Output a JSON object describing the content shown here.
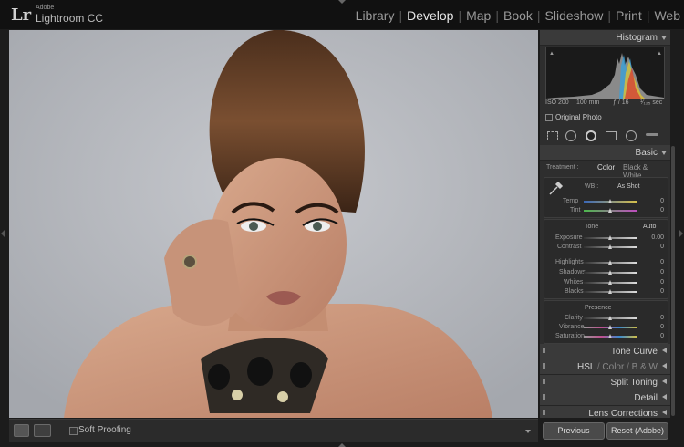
{
  "app": {
    "small": "Adobe",
    "name": "Lightroom CC",
    "logo": "Lr"
  },
  "modules": [
    {
      "label": "Library",
      "active": false
    },
    {
      "label": "Develop",
      "active": true
    },
    {
      "label": "Map",
      "active": false
    },
    {
      "label": "Book",
      "active": false
    },
    {
      "label": "Slideshow",
      "active": false
    },
    {
      "label": "Print",
      "active": false
    },
    {
      "label": "Web",
      "active": false
    }
  ],
  "toolbar": {
    "soft_proofing": "Soft Proofing"
  },
  "histogram": {
    "title": "Histogram",
    "iso": "ISO 200",
    "focal": "100 mm",
    "aperture": "ƒ / 16",
    "shutter": "¹⁄₁₂₅ sec",
    "original_photo": "Original Photo"
  },
  "basic": {
    "title": "Basic",
    "treatment_label": "Treatment :",
    "treatment_color": "Color",
    "treatment_bw": "Black & White",
    "wb_label": "WB :",
    "wb_value": "As Shot",
    "tone_label": "Tone",
    "tone_auto": "Auto",
    "presence_label": "Presence",
    "wb_sliders": [
      {
        "label": "Temp",
        "value": "0"
      },
      {
        "label": "Tint",
        "value": "0"
      }
    ],
    "tone_sliders": [
      {
        "label": "Exposure",
        "value": "0.00"
      },
      {
        "label": "Contrast",
        "value": "0"
      }
    ],
    "tone_sliders2": [
      {
        "label": "Highlights",
        "value": "0"
      },
      {
        "label": "Shadows",
        "value": "0"
      },
      {
        "label": "Whites",
        "value": "0"
      },
      {
        "label": "Blacks",
        "value": "0"
      }
    ],
    "presence_sliders": [
      {
        "label": "Clarity",
        "value": "0"
      },
      {
        "label": "Vibrance",
        "value": "0"
      },
      {
        "label": "Saturation",
        "value": "0"
      }
    ]
  },
  "panels": {
    "tone_curve": "Tone Curve",
    "hsl": "HSL",
    "sep1": "/",
    "color": "Color",
    "sep2": "/",
    "bw": "B & W",
    "split_toning": "Split Toning",
    "detail": "Detail",
    "lens_corrections": "Lens Corrections"
  },
  "buttons": {
    "previous": "Previous",
    "reset": "Reset (Adobe)"
  },
  "colors": {
    "accent": "#e8e8e8",
    "panel_bg": "#2e2e2e",
    "canvas_bg": "#b1b4ba"
  }
}
